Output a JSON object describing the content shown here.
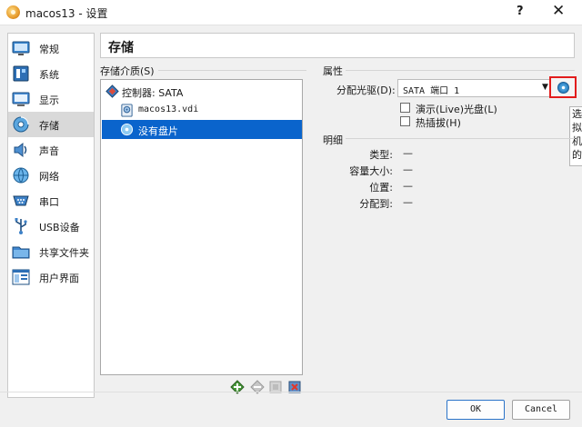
{
  "window": {
    "title": "macos13 - 设置",
    "help_glyph": "?",
    "close_glyph": "✕"
  },
  "sidebar": {
    "items": [
      {
        "label": "常规",
        "icon": "general-icon"
      },
      {
        "label": "系统",
        "icon": "system-icon"
      },
      {
        "label": "显示",
        "icon": "display-icon"
      },
      {
        "label": "存储",
        "icon": "storage-icon",
        "selected": true
      },
      {
        "label": "声音",
        "icon": "audio-icon"
      },
      {
        "label": "网络",
        "icon": "network-icon"
      },
      {
        "label": "串口",
        "icon": "serial-port-icon"
      },
      {
        "label": "USB设备",
        "icon": "usb-icon"
      },
      {
        "label": "共享文件夹",
        "icon": "shared-folder-icon"
      },
      {
        "label": "用户界面",
        "icon": "user-interface-icon"
      }
    ]
  },
  "page": {
    "title": "存储"
  },
  "storage_tree": {
    "label": "存储介质(S)",
    "items": [
      {
        "label": "控制器: SATA",
        "icon": "controller-icon"
      },
      {
        "label": "macos13.vdi",
        "icon": "hard-disk-icon"
      },
      {
        "label": "没有盘片",
        "icon": "optical-disc-icon",
        "selected": true
      }
    ],
    "toolbar_icons": [
      "add-attachment-icon",
      "remove-attachment-icon",
      "controller-settings-icon",
      "remove-controller-icon"
    ]
  },
  "attributes": {
    "section_label": "属性",
    "drive_label": "分配光驱(D):",
    "drive_value": "SATA 端口 1",
    "disk_button_icon": "optical-disc-icon",
    "live_cd_label": "演示(Live)光盘(L)",
    "live_cd_checked": false,
    "hotplug_label": "热插拔(H)",
    "hotplug_checked": false,
    "tooltip_chars": [
      "选",
      "拟",
      "机",
      "的"
    ]
  },
  "details": {
    "section_label": "明细",
    "rows": [
      {
        "key": "类型:",
        "value": "—"
      },
      {
        "key": "容量大小:",
        "value": "—"
      },
      {
        "key": "位置:",
        "value": "—"
      },
      {
        "key": "分配到:",
        "value": "—"
      }
    ]
  },
  "buttons": {
    "ok": "OK",
    "cancel": "Cancel"
  }
}
